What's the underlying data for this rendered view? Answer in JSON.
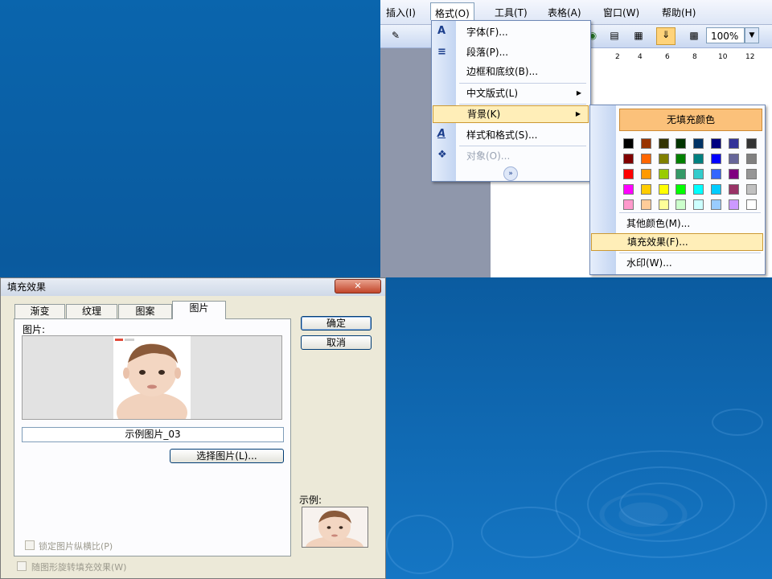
{
  "menubar": {
    "items": [
      "插入(I)",
      "格式(O)",
      "工具(T)",
      "表格(A)",
      "窗口(W)",
      "帮助(H)"
    ]
  },
  "toolbar": {
    "zoom": "100%"
  },
  "ruler": {
    "ticks": [
      "2",
      "4",
      "6",
      "8",
      "10",
      "12"
    ]
  },
  "format_menu": {
    "items": [
      "字体(F)...",
      "段落(P)...",
      "边框和底纹(B)...",
      "中文版式(L)",
      "背景(K)",
      "样式和格式(S)...",
      "对象(O)..."
    ],
    "icons": {
      "font": "A",
      "styles": "A"
    }
  },
  "background_menu": {
    "no_fill": "无填充颜色",
    "colors": [
      [
        "#000000",
        "#993300",
        "#333300",
        "#003300",
        "#003366",
        "#000080",
        "#333399",
        "#333333"
      ],
      [
        "#800000",
        "#ff6600",
        "#808000",
        "#008000",
        "#008080",
        "#0000ff",
        "#666699",
        "#808080"
      ],
      [
        "#ff0000",
        "#ff9900",
        "#99cc00",
        "#339966",
        "#33cccc",
        "#3366ff",
        "#800080",
        "#969696"
      ],
      [
        "#ff00ff",
        "#ffcc00",
        "#ffff00",
        "#00ff00",
        "#00ffff",
        "#00ccff",
        "#993366",
        "#c0c0c0"
      ],
      [
        "#ff99cc",
        "#ffcc99",
        "#ffff99",
        "#ccffcc",
        "#ccffff",
        "#99ccff",
        "#cc99ff",
        "#ffffff"
      ]
    ],
    "more_colors": "其他颜色(M)...",
    "fill_effects": "填充效果(F)...",
    "watermark": "水印(W)..."
  },
  "dialog": {
    "title": "填充效果",
    "close": "✕",
    "tabs": [
      "渐变",
      "纹理",
      "图案",
      "图片"
    ],
    "picture_label": "图片:",
    "picture_name": "示例图片_03",
    "select_picture": "选择图片(L)...",
    "ok": "确定",
    "cancel": "取消",
    "sample_label": "示例:",
    "lock_aspect": "锁定图片纵横比(P)",
    "rotate_fill": "随图形旋转填充效果(W)"
  }
}
